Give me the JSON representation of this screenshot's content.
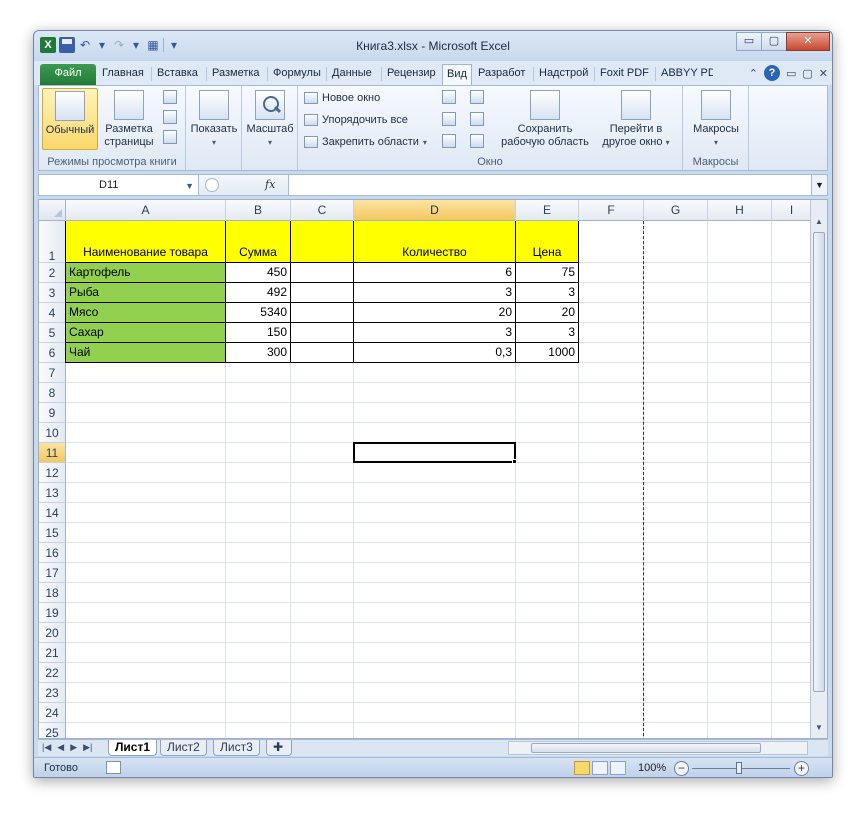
{
  "window": {
    "title": "Книга3.xlsx  -  Microsoft Excel",
    "minimize": "▭",
    "restore": "▢",
    "close": "✕"
  },
  "ribbon_tabs": [
    "Файл",
    "Главная",
    "Вставка",
    "Разметка",
    "Формулы",
    "Данные",
    "Рецензир",
    "Вид",
    "Разработ",
    "Надстрой",
    "Foxit PDF",
    "ABBYY PD"
  ],
  "active_tab": "Вид",
  "ribbon": {
    "view_group": {
      "label": "Режимы просмотра книги",
      "normal": "Обычный",
      "page_layout_line1": "Разметка",
      "page_layout_line2": "страницы"
    },
    "show": "Показать",
    "zoom": "Масштаб",
    "window_group": {
      "label": "Окно",
      "new_window": "Новое окно",
      "arrange_all": "Упорядочить все",
      "freeze_panes": "Закрепить области",
      "save_workspace_line1": "Сохранить",
      "save_workspace_line2": "рабочую область",
      "switch_windows_line1": "Перейти в",
      "switch_windows_line2": "другое окно"
    },
    "macros_group": {
      "label": "Макросы",
      "macros": "Макросы"
    }
  },
  "formula_bar": {
    "name_box": "D11",
    "fx": "fx",
    "formula": ""
  },
  "columns": [
    "A",
    "B",
    "C",
    "D",
    "E",
    "F",
    "G",
    "H",
    "I"
  ],
  "selected_column": "D",
  "rows": [
    "1",
    "2",
    "3",
    "4",
    "5",
    "6",
    "7",
    "8",
    "9",
    "10",
    "11",
    "12",
    "13",
    "14",
    "15",
    "16",
    "17",
    "18",
    "19",
    "20",
    "21",
    "22",
    "23",
    "24",
    "25"
  ],
  "selected_row": "11",
  "table": {
    "headers": {
      "A": "Наименование товара",
      "B": "Сумма",
      "D": "Количество",
      "E": "Цена"
    },
    "data": [
      {
        "A": "Картофель",
        "B": "450",
        "D": "6",
        "E": "75"
      },
      {
        "A": "Рыба",
        "B": "492",
        "D": "3",
        "E": "3"
      },
      {
        "A": "Мясо",
        "B": "5340",
        "D": "20",
        "E": "20"
      },
      {
        "A": "Сахар",
        "B": "150",
        "D": "3",
        "E": "3"
      },
      {
        "A": "Чай",
        "B": "300",
        "D": "0,3",
        "E": "1000"
      }
    ]
  },
  "colors": {
    "header_fill": "#ffff00",
    "name_fill": "#92d050",
    "selection_header": "#f4c860"
  },
  "sheets": [
    "Лист1",
    "Лист2",
    "Лист3"
  ],
  "active_sheet": "Лист1",
  "status": {
    "ready": "Готово",
    "zoom": "100%",
    "zoom_out": "−",
    "zoom_in": "+"
  }
}
